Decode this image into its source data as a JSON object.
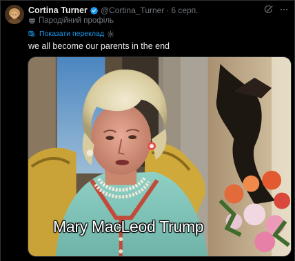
{
  "tweet": {
    "display_name": "Cortina Turner",
    "handle": "@Cortina_Turner",
    "separator": "·",
    "date": "6 серп.",
    "parody_label": "Пародійний профіль",
    "translate_link": "Показати переклад",
    "text": "we all become our parents in the end",
    "media": {
      "caption": "Mary MacLeod Trump"
    }
  },
  "colors": {
    "background": "#000000",
    "text_primary": "#e7e9ea",
    "text_secondary": "#71767b",
    "accent": "#1d9bf0",
    "border": "#2f3336"
  },
  "icons": {
    "verified": "verified-badge-icon",
    "grok": "grok-icon",
    "more": "more-icon",
    "parody": "mask-icon",
    "translate": "translate-icon",
    "settings": "settings-icon"
  }
}
